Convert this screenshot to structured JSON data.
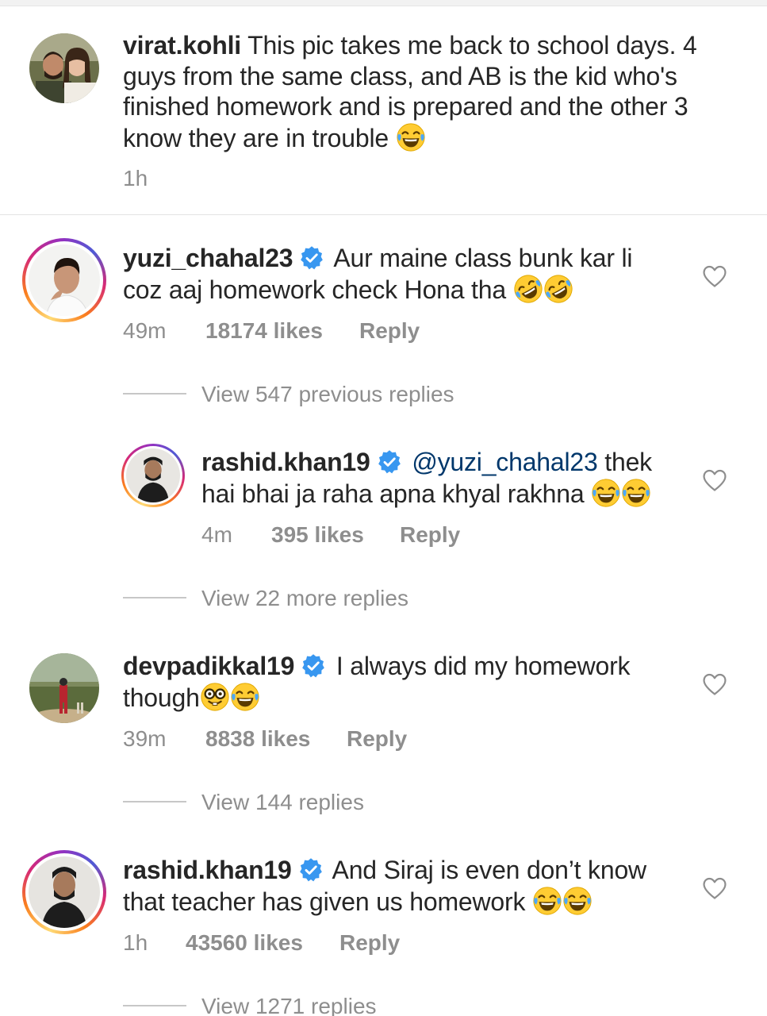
{
  "caption": {
    "username": "virat.kohli",
    "text": "This pic takes me back to school days. 4 guys from the same class, and  AB is the kid who's finished homework and is prepared and the other 3 know they are in trouble",
    "emoji": "joy-emoji",
    "time": "1h"
  },
  "comments": [
    {
      "username": "yuzi_chahal23",
      "verified": true,
      "text": "Aur maine class bunk kar li coz aaj homework check Hona tha",
      "emoji": "rofl-emoji x2",
      "time": "49m",
      "likes": "18174 likes",
      "reply_label": "Reply",
      "view_replies": "View 547 previous replies"
    },
    {
      "username": "rashid.khan19",
      "verified": true,
      "is_reply": true,
      "mention": "@yuzi_chahal23",
      "text": "thek hai bhai ja raha apna khyal rakhna",
      "emoji": "joy-emoji x2",
      "time": "4m",
      "likes": "395 likes",
      "reply_label": "Reply",
      "view_replies": "View 22 more replies"
    },
    {
      "username": "devpadikkal19",
      "verified": true,
      "text": "I always did my homework though",
      "emoji": "nerd-emoji + joy-emoji",
      "time": "39m",
      "likes": "8838 likes",
      "reply_label": "Reply",
      "view_replies": "View 144 replies"
    },
    {
      "username": "rashid.khan19",
      "verified": true,
      "text": "And Siraj is even don’t know that teacher has given us homework",
      "emoji": "joy-emoji x2",
      "time": "1h",
      "likes": "43560 likes",
      "reply_label": "Reply",
      "view_replies": "View 1271 replies"
    }
  ],
  "colors": {
    "text": "#262626",
    "secondary": "#8e8e8e",
    "verified_blue": "#3897f0",
    "mention": "#00376b"
  },
  "icons": [
    "heart-icon",
    "verified-badge-icon"
  ]
}
